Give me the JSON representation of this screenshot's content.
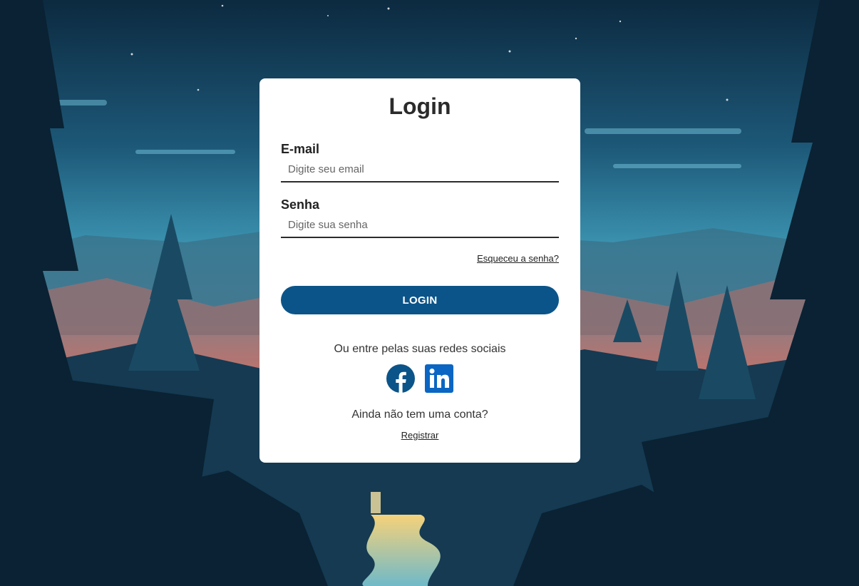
{
  "login": {
    "title": "Login",
    "email_label": "E-mail",
    "email_placeholder": "Digite seu email",
    "password_label": "Senha",
    "password_placeholder": "Digite sua senha",
    "forgot_link": "Esqueceu a senha?",
    "login_button": "LOGIN",
    "social_prompt": "Ou entre pelas suas redes sociais",
    "social_icons": [
      "facebook-icon",
      "linkedin-icon"
    ],
    "no_account_text": "Ainda não tem uma conta?",
    "register_link": "Registrar"
  },
  "colors": {
    "button": "#0b5489",
    "facebook": "#0b5489",
    "linkedin": "#0a66c2",
    "card": "#ffffff"
  }
}
